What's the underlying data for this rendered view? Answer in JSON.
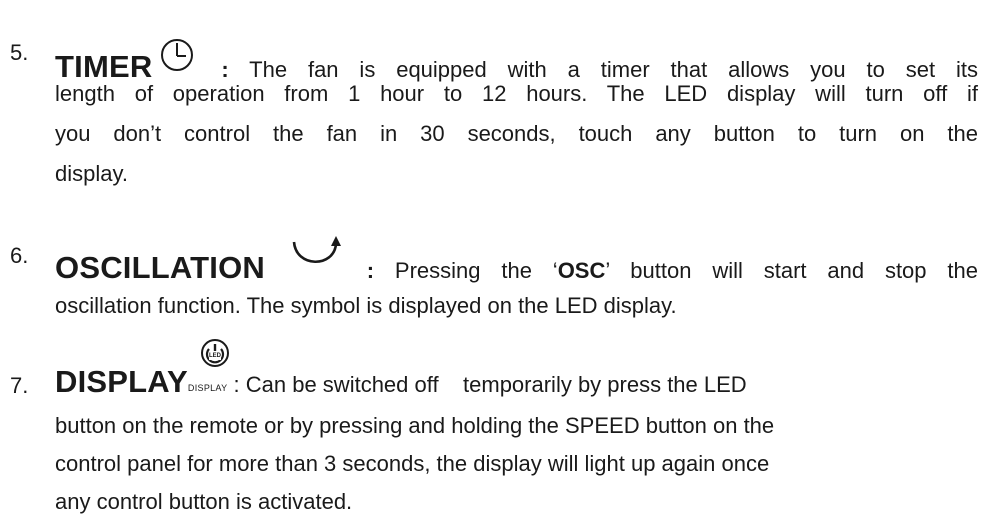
{
  "items": [
    {
      "number": "5.",
      "title": "TIMER",
      "icon": "clock-icon",
      "colon": ":",
      "lines": [
        "The fan is equipped with a timer that allows you to set its",
        "length of operation from 1 hour to 12 hours. The LED display will turn off if",
        "you don’t control the fan in 30 seconds, touch any button to turn on the",
        "display."
      ]
    },
    {
      "number": "6.",
      "title": "OSCILLATION",
      "icon": "oscillation-icon",
      "colon": ":",
      "text_a": "Pressing the ‘",
      "text_b": "OSC",
      "text_c": "’ button will start and stop the",
      "lines": [
        "oscillation function. The symbol is displayed on the LED display."
      ]
    },
    {
      "number": "7.",
      "title": "DISPLAY",
      "icon": "led-power-icon",
      "icon_label": "LED",
      "icon_sublabel": "DISPLAY",
      "colon": ":",
      "lines": [
        "Can be switched off    temporarily by press the LED",
        "button on the remote or by pressing and holding the SPEED button on the",
        "control panel for more than 3 seconds, the display will light up again once",
        "any control button is activated."
      ]
    }
  ]
}
